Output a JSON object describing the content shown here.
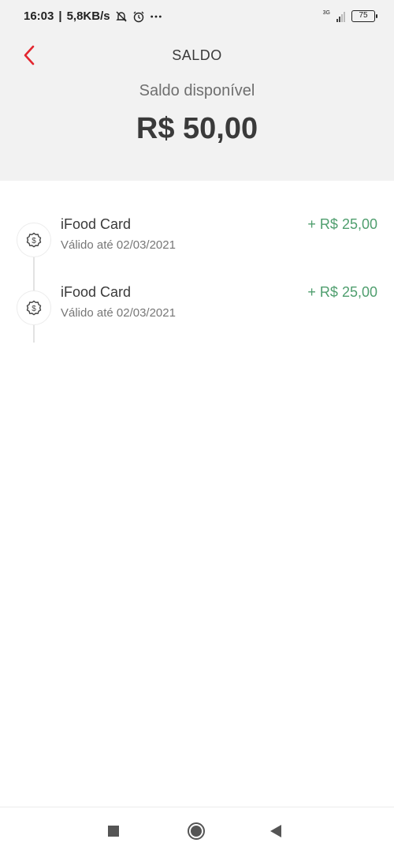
{
  "status_bar": {
    "time": "16:03",
    "speed": "5,8KB/s",
    "network": "3G",
    "battery": "75"
  },
  "header": {
    "title": "SALDO",
    "back_icon": "chevron-left-icon"
  },
  "balance": {
    "label": "Saldo disponível",
    "value": "R$ 50,00"
  },
  "transactions": [
    {
      "title": "iFood Card",
      "subtitle": "Válido até 02/03/2021",
      "amount": "+ R$ 25,00",
      "icon": "dollar-badge-icon"
    },
    {
      "title": "iFood Card",
      "subtitle": "Válido até 02/03/2021",
      "amount": "+ R$ 25,00",
      "icon": "dollar-badge-icon"
    }
  ],
  "colors": {
    "accent_red": "#e3262f",
    "positive_green": "#4f9e6e",
    "panel_gray": "#f2f2f2"
  },
  "nav": {
    "recent_icon": "square-icon",
    "home_icon": "circle-home-icon",
    "back_icon": "triangle-back-icon"
  }
}
